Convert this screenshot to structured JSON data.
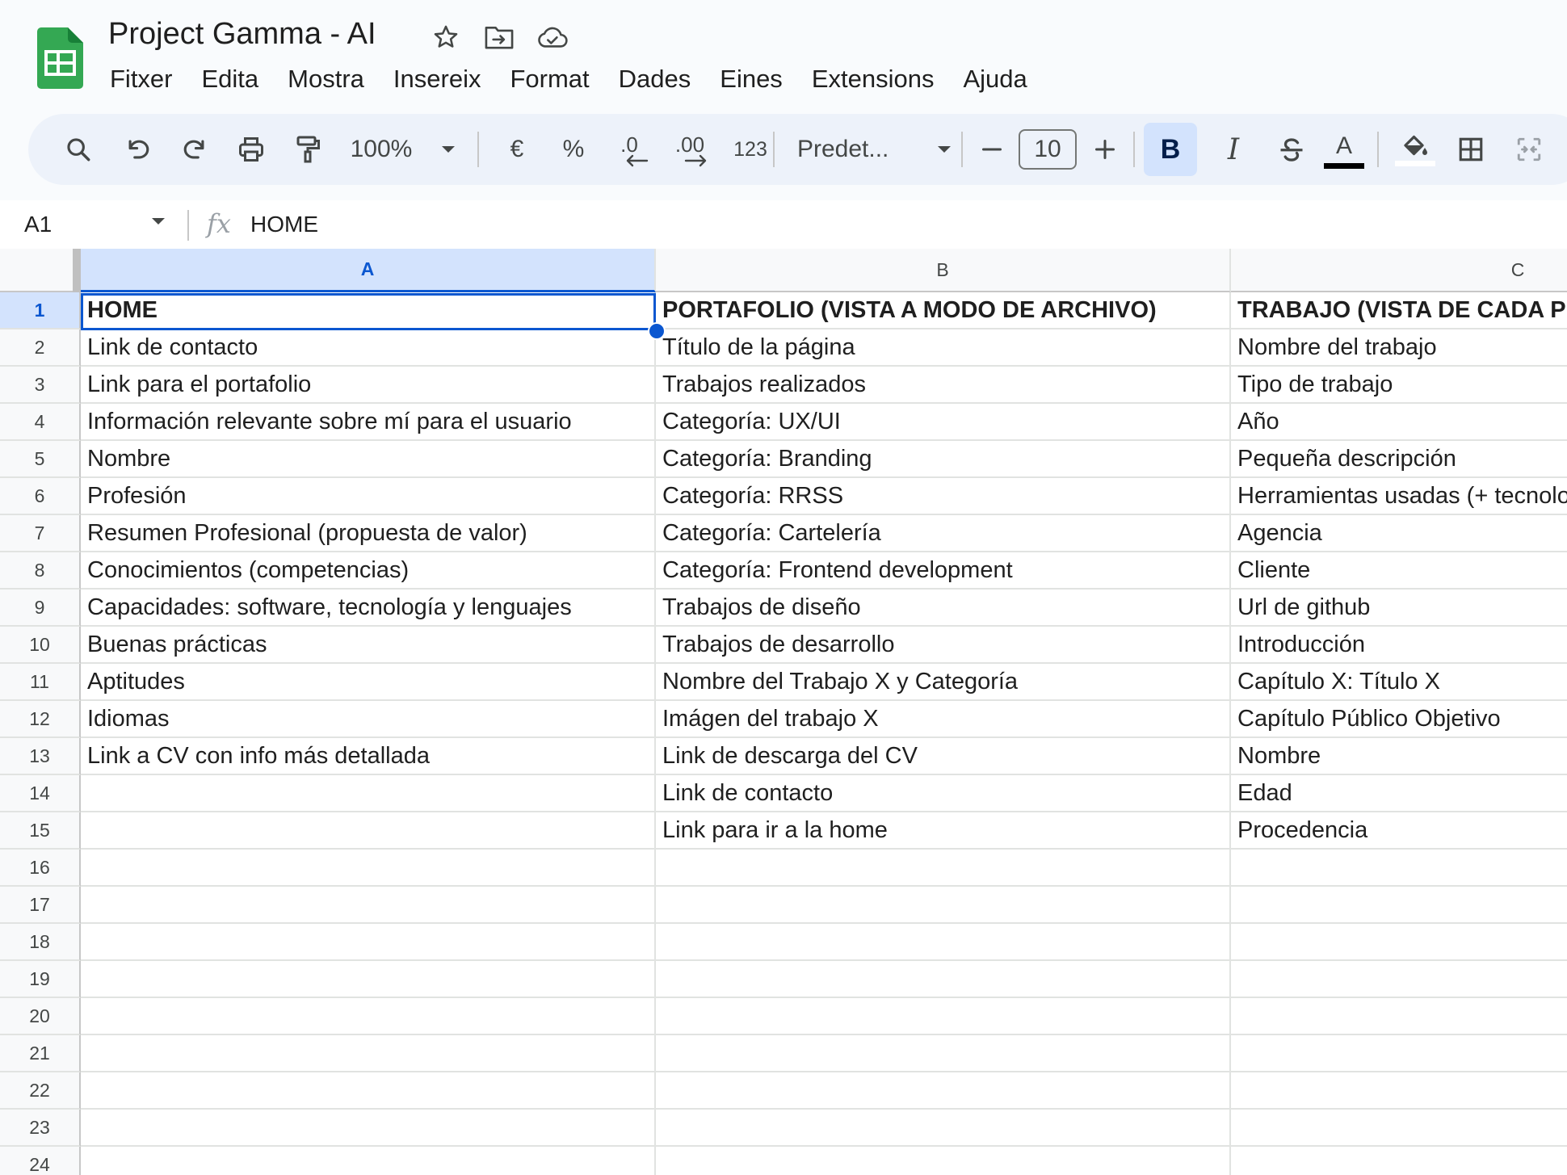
{
  "app": {
    "title": "Project Gamma - AI",
    "icons": [
      "sheets-logo-icon",
      "star-icon",
      "move-to-folder-icon",
      "cloud-saved-icon"
    ],
    "accent_color": "#0b57d0",
    "logo_color": "#34a853"
  },
  "menu": {
    "items": [
      "Fitxer",
      "Edita",
      "Mostra",
      "Insereix",
      "Format",
      "Dades",
      "Eines",
      "Extensions",
      "Ajuda"
    ]
  },
  "toolbar": {
    "zoom": "100%",
    "currency": "€",
    "percent": "%",
    "decrease_decimals": ".0",
    "increase_decimals": ".00",
    "number_format": "123",
    "font": "Predet...",
    "font_size": "10",
    "bold": "B",
    "italic": "I",
    "text_color_label": "A",
    "bold_active": true,
    "icons": [
      "search-icon",
      "undo-icon",
      "redo-icon",
      "print-icon",
      "paint-format-icon",
      "zoom-dropdown-icon",
      "font-dropdown-icon",
      "minus-icon",
      "plus-icon",
      "strikethrough-icon",
      "text-color-icon",
      "fill-color-icon",
      "borders-icon",
      "merge-cells-icon"
    ]
  },
  "formula_bar": {
    "name_box": "A1",
    "fx": "fx",
    "content": "HOME"
  },
  "sheet": {
    "columns": [
      "A",
      "B",
      "C"
    ],
    "row_numbers": [
      "1",
      "2",
      "3",
      "4",
      "5",
      "6",
      "7",
      "8",
      "9",
      "10",
      "11",
      "12",
      "13",
      "14",
      "15",
      "16",
      "17",
      "18",
      "19",
      "20",
      "21",
      "22",
      "23",
      "24"
    ],
    "selected_cell": "A1",
    "rows": [
      [
        "HOME",
        "PORTAFOLIO (VISTA A MODO DE ARCHIVO)",
        "TRABAJO (VISTA DE CADA P"
      ],
      [
        "Link de contacto",
        "Título de la página",
        "Nombre del trabajo"
      ],
      [
        "Link para el portafolio",
        "Trabajos realizados",
        "Tipo de trabajo"
      ],
      [
        "Información relevante sobre mí para el usuario",
        "Categoría: UX/UI",
        "Año"
      ],
      [
        "Nombre",
        "Categoría: Branding",
        "Pequeña descripción"
      ],
      [
        "Profesión",
        "Categoría: RRSS",
        "Herramientas usadas (+ tecnolo"
      ],
      [
        "Resumen Profesional (propuesta de valor)",
        "Categoría: Cartelería",
        "Agencia"
      ],
      [
        "Conocimientos (competencias)",
        "Categoría: Frontend development",
        "Cliente"
      ],
      [
        "Capacidades: software, tecnología y lenguajes",
        "Trabajos de diseño",
        "Url de github"
      ],
      [
        "Buenas prácticas",
        "Trabajos de desarrollo",
        "Introducción"
      ],
      [
        "Aptitudes",
        "Nombre del Trabajo X y Categoría",
        "Capítulo X: Título X"
      ],
      [
        "Idiomas",
        "Imágen del trabajo X",
        "Capítulo Público Objetivo"
      ],
      [
        "Link a CV con info más detallada",
        "Link de descarga del CV",
        "Nombre"
      ],
      [
        "",
        "Link de contacto",
        "Edad"
      ],
      [
        "",
        "Link para ir a la home",
        "Procedencia"
      ],
      [
        "",
        "",
        ""
      ],
      [
        "",
        "",
        ""
      ],
      [
        "",
        "",
        ""
      ],
      [
        "",
        "",
        ""
      ],
      [
        "",
        "",
        ""
      ],
      [
        "",
        "",
        ""
      ],
      [
        "",
        "",
        ""
      ],
      [
        "",
        "",
        ""
      ],
      [
        "",
        "",
        ""
      ]
    ]
  }
}
